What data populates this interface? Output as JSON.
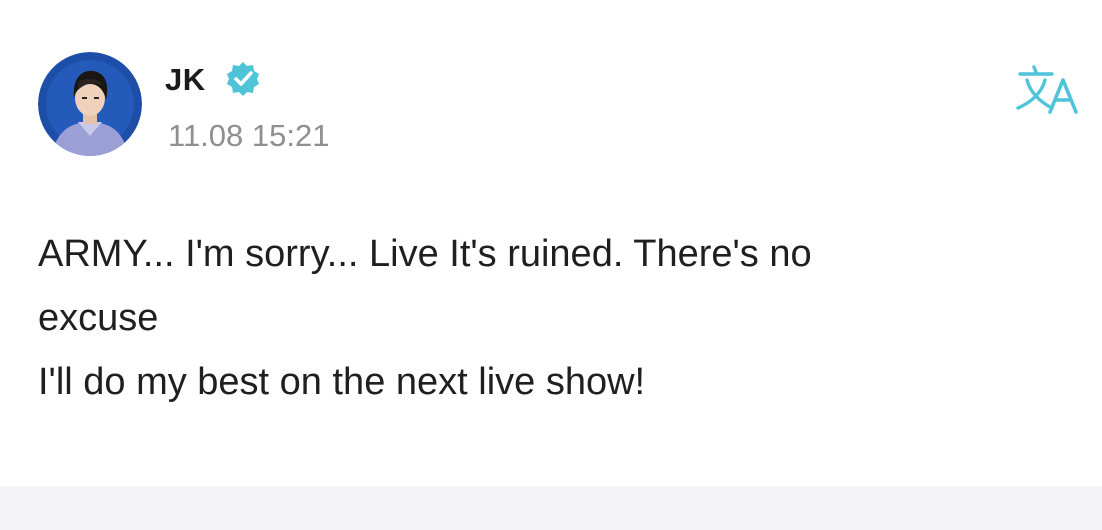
{
  "post": {
    "author": {
      "name": "JK",
      "verified": true,
      "verified_icon": "verified-badge-icon",
      "avatar_icon": "profile-photo"
    },
    "timestamp": "11.08 15:21",
    "translate_icon": "translate-icon",
    "body_lines": [
      "ARMY... I'm sorry... Live It's ruined. There's no",
      "excuse",
      "I'll do my best on the next live show!"
    ]
  },
  "colors": {
    "accent": "#4fc3d8",
    "timestamp": "#8e8e93",
    "avatar_background": "#1d4fa8"
  }
}
